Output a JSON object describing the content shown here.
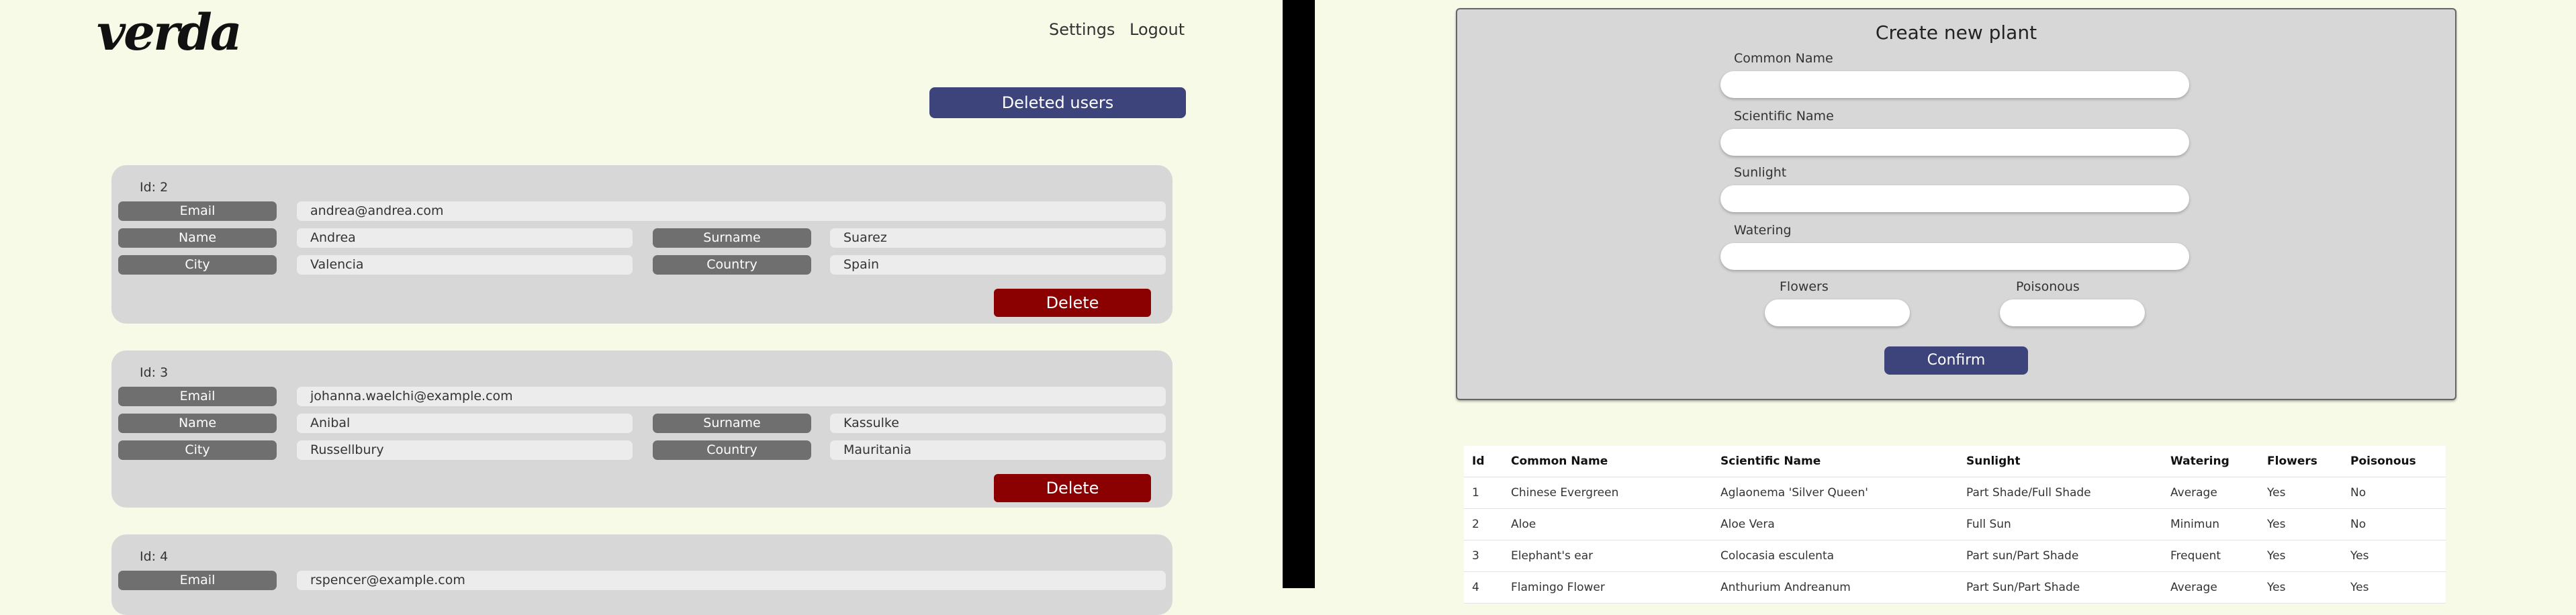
{
  "left": {
    "logo": "verda",
    "nav": {
      "settings": "Settings",
      "logout": "Logout"
    },
    "deleted_users_label": "Deleted users",
    "field_labels": {
      "email": "Email",
      "name": "Name",
      "surname": "Surname",
      "city": "City",
      "country": "Country"
    },
    "delete_label": "Delete",
    "users": [
      {
        "id": "Id: 2",
        "email": "andrea@andrea.com",
        "name": "Andrea",
        "surname": "Suarez",
        "city": "Valencia",
        "country": "Spain"
      },
      {
        "id": "Id: 3",
        "email": "johanna.waelchi@example.com",
        "name": "Anibal",
        "surname": "Kassulke",
        "city": "Russellbury",
        "country": "Mauritania"
      },
      {
        "id": "Id: 4",
        "email": "rspencer@example.com"
      }
    ]
  },
  "right": {
    "form": {
      "title": "Create new plant",
      "common_name_label": "Common Name",
      "scientific_name_label": "Scientific Name",
      "sunlight_label": "Sunlight",
      "watering_label": "Watering",
      "flowers_label": "Flowers",
      "poisonous_label": "Poisonous",
      "confirm_label": "Confirm"
    },
    "table": {
      "headers": [
        "Id",
        "Common Name",
        "Scientific Name",
        "Sunlight",
        "Watering",
        "Flowers",
        "Poisonous"
      ],
      "rows": [
        [
          "1",
          "Chinese Evergreen",
          "Aglaonema 'Silver Queen'",
          "Part Shade/Full Shade",
          "Average",
          "Yes",
          "No"
        ],
        [
          "2",
          "Aloe",
          "Aloe Vera",
          "Full Sun",
          "Minimun",
          "Yes",
          "No"
        ],
        [
          "3",
          "Elephant's ear",
          "Colocasia esculenta",
          "Part sun/Part Shade",
          "Frequent",
          "Yes",
          "Yes"
        ],
        [
          "4",
          "Flamingo Flower",
          "Anthurium Andreanum",
          "Part Sun/Part Shade",
          "Average",
          "Yes",
          "Yes"
        ]
      ]
    }
  },
  "colors": {
    "background": "#f8fae8",
    "accent": "#3d447b",
    "danger": "#8b0000",
    "card": "#d7d7d7",
    "label": "#6f6f6f"
  }
}
